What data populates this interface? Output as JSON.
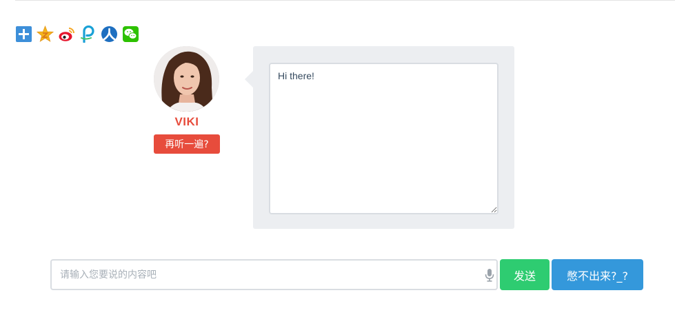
{
  "share": {
    "icons": [
      "more-share-icon",
      "qzone-icon",
      "weibo-icon",
      "tencent-pengyou-icon",
      "renren-icon",
      "wechat-icon"
    ]
  },
  "profile": {
    "name": "VIKI",
    "replay_label": "再听一遍?"
  },
  "bubble": {
    "text": "Hi there!"
  },
  "input": {
    "placeholder": "请输入您要说的内容吧",
    "value": ""
  },
  "buttons": {
    "send_label": "发送",
    "stuck_label": "憋不出来?_?"
  },
  "colors": {
    "accent_red": "#e74c3c",
    "send_green": "#2ecc71",
    "stuck_blue": "#3498db",
    "bubble_bg": "#eceef1"
  }
}
